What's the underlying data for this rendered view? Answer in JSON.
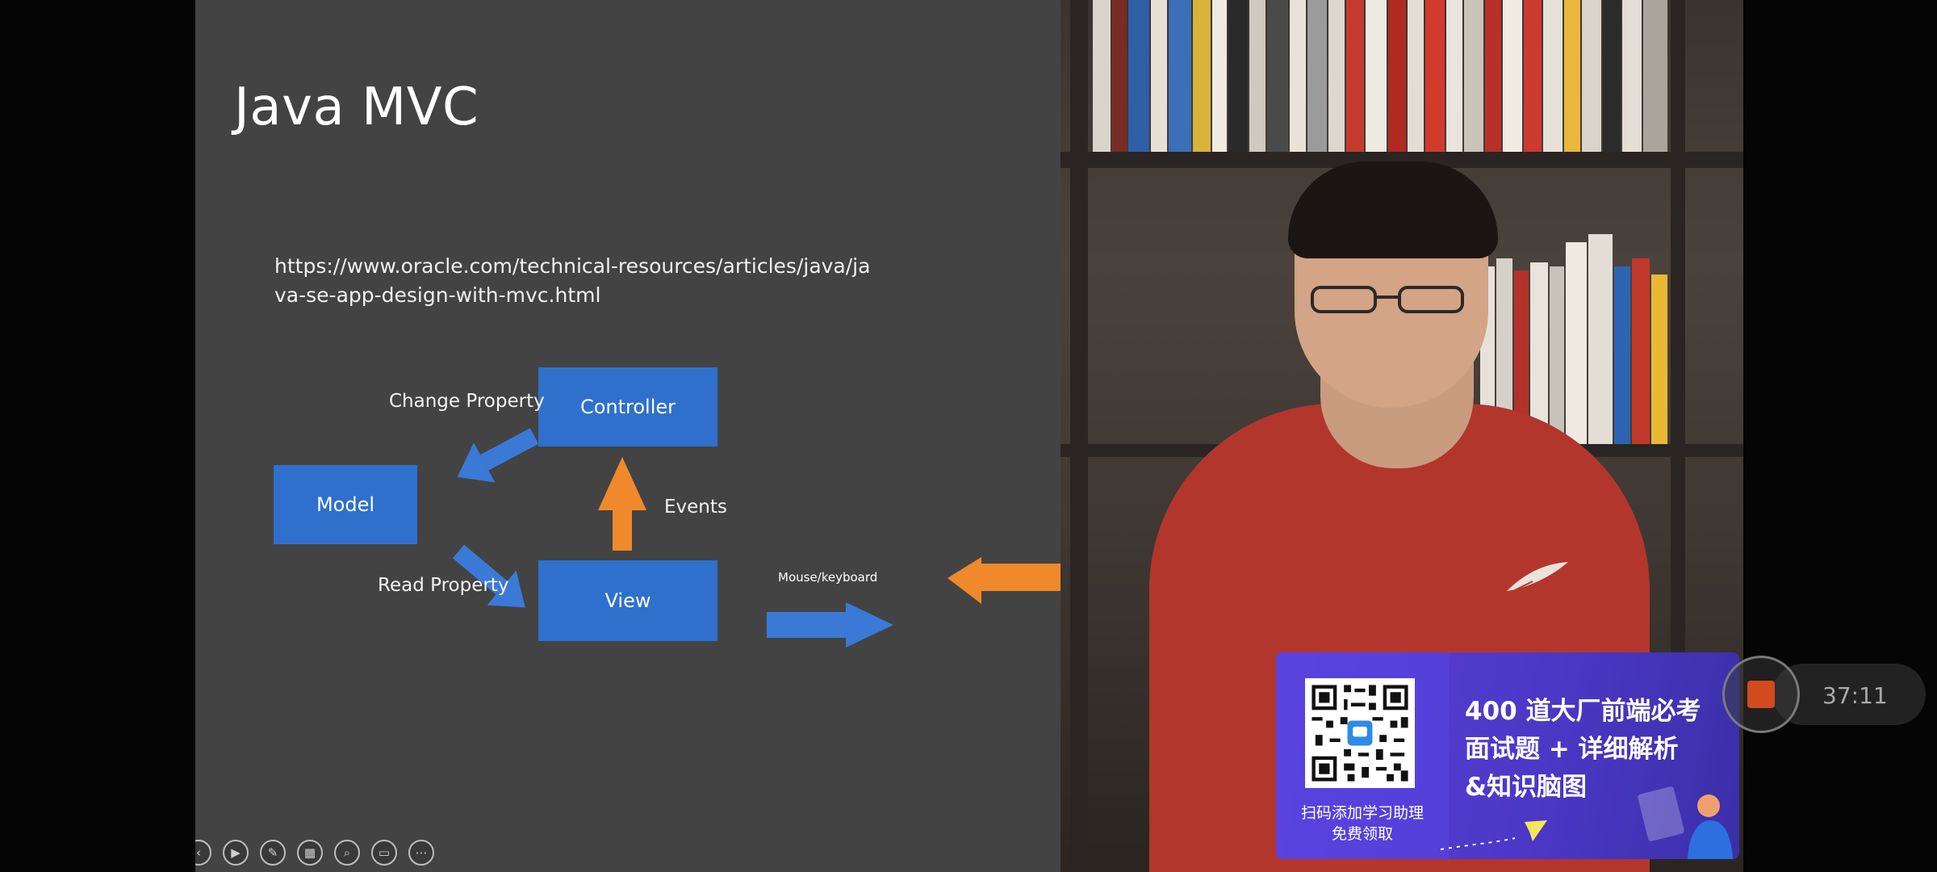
{
  "slide": {
    "title": "Java MVC",
    "url": "https://www.oracle.com/technical-resources/articles/java/java-se-app-design-with-mvc.html"
  },
  "diagram": {
    "boxes": {
      "model": "Model",
      "controller": "Controller",
      "view": "View"
    },
    "labels": {
      "change_property": "Change Property",
      "read_property": "Read Property",
      "events": "Events",
      "mouse_keyboard": "Mouse/keyboard"
    },
    "colors": {
      "box": "#2f70cc",
      "arrow_blue": "#3a7ad6",
      "arrow_orange": "#f0882c"
    }
  },
  "toolbar": {
    "icons": [
      "prev-icon",
      "play-icon",
      "pen-icon",
      "slides-icon",
      "zoom-icon",
      "screen-icon",
      "more-icon"
    ],
    "glyphs": [
      "‹",
      "▶",
      "✎",
      "▦",
      "⌕",
      "▭",
      "⋯"
    ]
  },
  "ad": {
    "qr_caption_line1": "扫码添加学习助理",
    "qr_caption_line2": "免费领取",
    "headline_line1": "400 道大厂前端必考",
    "headline_line2": "面试题 + 详细解析",
    "headline_line3": "&知识脑图"
  },
  "recorder": {
    "timer": "37:11"
  }
}
